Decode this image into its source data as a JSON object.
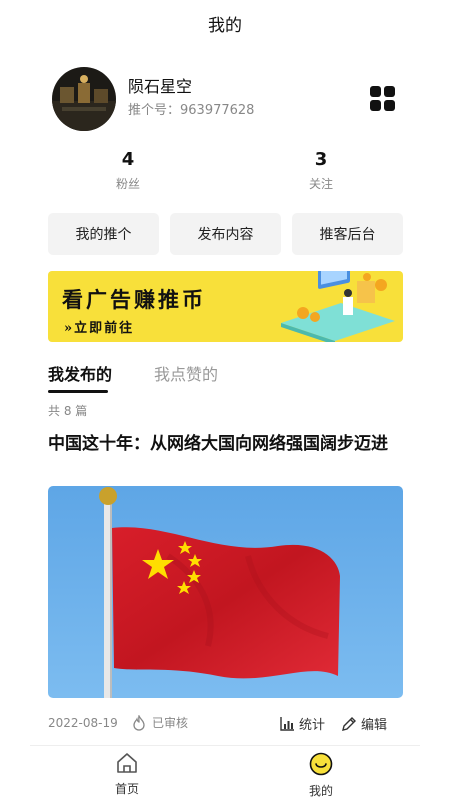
{
  "header": {
    "title": "我的"
  },
  "profile": {
    "name": "陨石星空",
    "id_text": "推个号：963977628"
  },
  "stats": {
    "fans": {
      "value": "4",
      "label": "粉丝"
    },
    "following": {
      "value": "3",
      "label": "关注"
    }
  },
  "actions": {
    "my_push": "我的推个",
    "publish": "发布内容",
    "backend": "推客后台"
  },
  "banner": {
    "title": "看广告赚推币",
    "subtitle": "»立即前往"
  },
  "tabs": {
    "published": "我发布的",
    "liked": "我点赞的"
  },
  "post_list": {
    "count_text": "共 8 篇",
    "post": {
      "title": "中国这十年：从网络大国向网络强国阔步迈进",
      "date": "2022-08-19",
      "status": "已审核",
      "stats_label": "统计",
      "edit_label": "编辑"
    }
  },
  "tabbar": {
    "home": "首页",
    "mine": "我的"
  },
  "colors": {
    "accent": "#f8e03a",
    "text": "#111111",
    "muted": "#888888"
  },
  "icons": [
    "grid-icon",
    "fire-icon",
    "bar-chart-icon",
    "pencil-icon",
    "home-icon",
    "smile-icon"
  ]
}
